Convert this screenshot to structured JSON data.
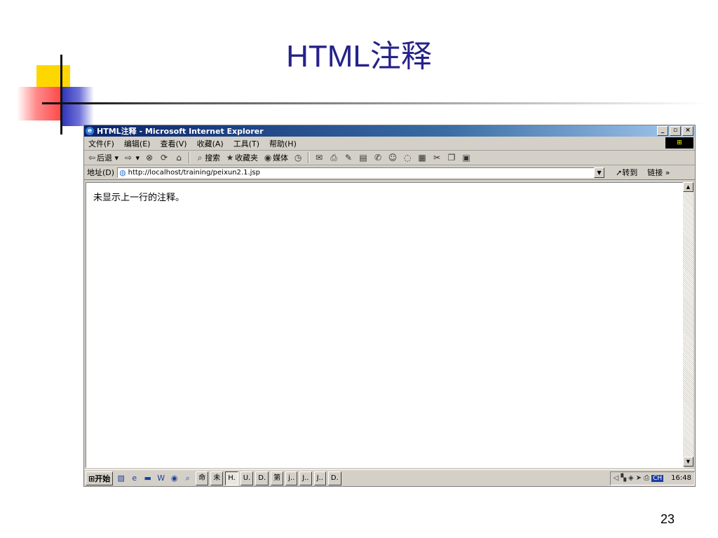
{
  "slide": {
    "title": "HTML注释",
    "page_number": "23"
  },
  "window": {
    "title": "HTML注释 - Microsoft Internet Explorer",
    "controls": {
      "minimize": "_",
      "restore": "▫",
      "close": "×"
    }
  },
  "menu": {
    "file": "文件(F)",
    "edit": "编辑(E)",
    "view": "查看(V)",
    "favorites": "收藏(A)",
    "tools": "工具(T)",
    "help": "帮助(H)"
  },
  "toolbar": {
    "back": "后退",
    "search": "搜索",
    "favorites": "收藏夹",
    "media": "媒体"
  },
  "address": {
    "label": "地址(D)",
    "url": "http://localhost/training/peixun2.1.jsp",
    "go": "转到",
    "links": "链接"
  },
  "page": {
    "content_text": "未显示上一行的注释。"
  },
  "taskbar": {
    "start": "开始",
    "tasks": [
      "命",
      "未",
      "H.",
      "U.",
      "D.",
      "第",
      "j..",
      "J..",
      "J..",
      "D."
    ],
    "active_task_index": 2,
    "ime": "CH",
    "clock": "16:48"
  }
}
